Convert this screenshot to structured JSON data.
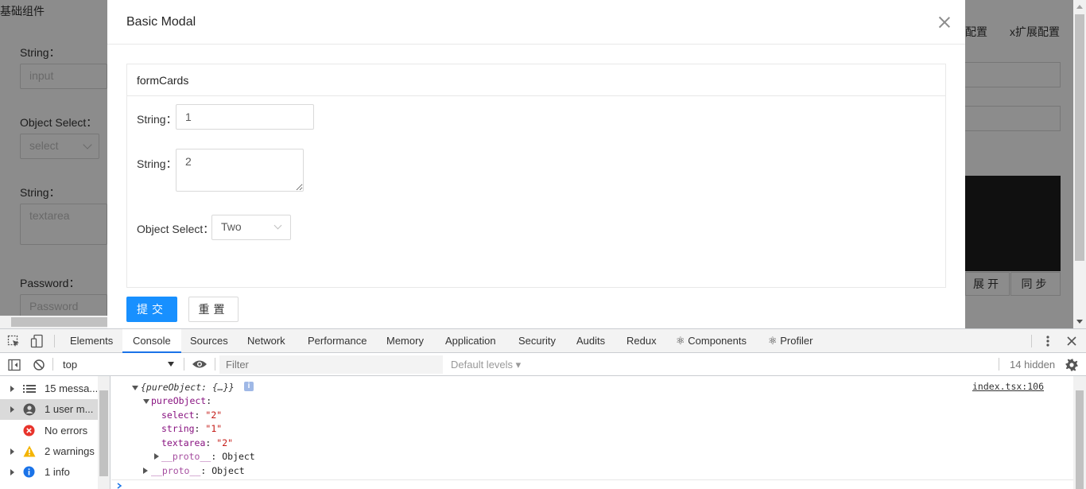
{
  "page": {
    "title": "基础组件",
    "labels": {
      "string1": "String：",
      "object_select": "Object Select：",
      "string2": "String：",
      "password": "Password："
    },
    "placeholders": {
      "input": "input",
      "select": "select",
      "textarea": "textarea",
      "password": "Password"
    },
    "right_tabs": [
      "配置",
      "x扩展配置"
    ],
    "right_buttons": [
      "展开",
      "同步"
    ]
  },
  "modal": {
    "title": "Basic Modal",
    "card_title": "formCards",
    "fields": {
      "string_label": "String：",
      "string_value": "1",
      "textarea_label": "String：",
      "textarea_value": "2",
      "select_label": "Object Select：",
      "select_value": "Two"
    },
    "submit_label": "提交",
    "reset_label": "重置",
    "colors": {
      "primary": "#1890ff"
    }
  },
  "devtools": {
    "tabs": [
      "Elements",
      "Console",
      "Sources",
      "Network",
      "Performance",
      "Memory",
      "Application",
      "Security",
      "Audits",
      "Redux",
      "⚛ Components",
      "⚛ Profiler"
    ],
    "active_tab": "Console",
    "context": "top",
    "filter_placeholder": "Filter",
    "levels": "Default levels ▾",
    "hidden": "14 hidden",
    "sidebar": [
      {
        "label": "15 messa...",
        "icon": "list-icon"
      },
      {
        "label": "1 user m...",
        "icon": "user-icon"
      },
      {
        "label": "No errors",
        "icon": "error-icon"
      },
      {
        "label": "2 warnings",
        "icon": "warning-icon"
      },
      {
        "label": "1 info",
        "icon": "info-icon"
      }
    ],
    "console": {
      "source": "index.tsx:106",
      "line1": "{pureObject: {…}}",
      "pure_key": "pureObject",
      "select_key": "select",
      "select_val": "\"2\"",
      "string_key": "string",
      "string_val": "\"1\"",
      "textarea_key": "textarea",
      "textarea_val": "\"2\"",
      "proto_key": "__proto__",
      "proto_val": "Object",
      "colon": ":"
    }
  }
}
